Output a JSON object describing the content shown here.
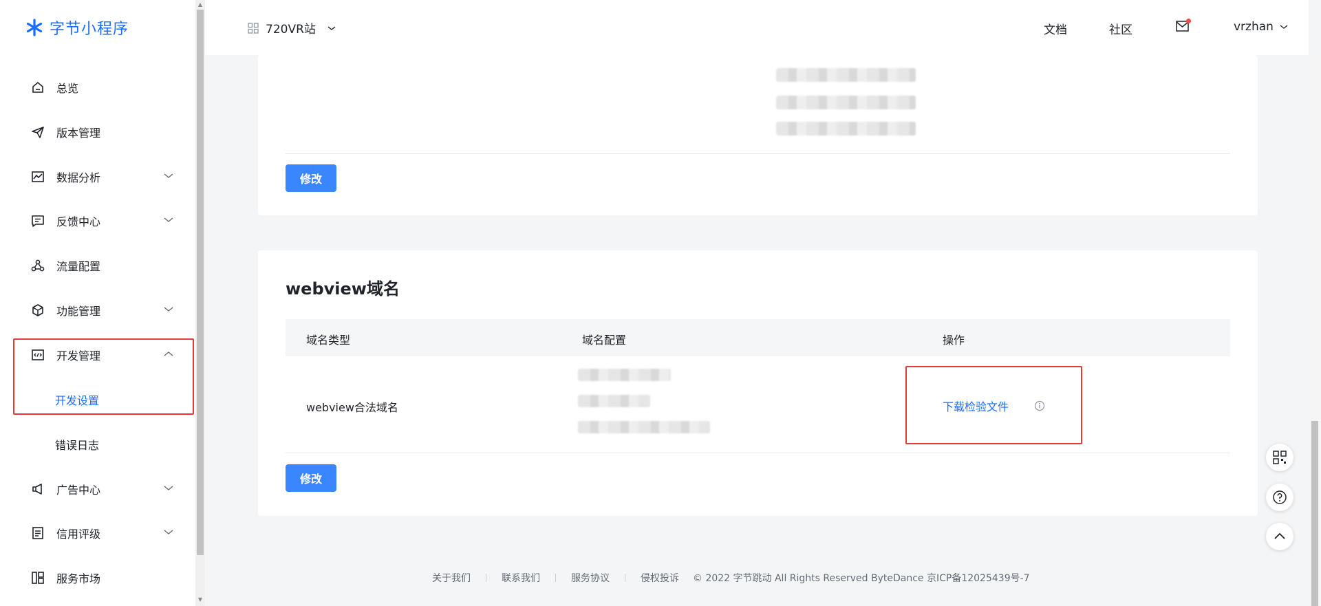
{
  "brand": {
    "name": "字节小程序",
    "accent": "#1a6cff"
  },
  "sidebar": {
    "items": [
      {
        "label": "总览",
        "icon": "home-icon"
      },
      {
        "label": "版本管理",
        "icon": "send-icon"
      },
      {
        "label": "数据分析",
        "icon": "chart-icon"
      },
      {
        "label": "反馈中心",
        "icon": "message-icon"
      },
      {
        "label": "流量配置",
        "icon": "network-icon"
      },
      {
        "label": "功能管理",
        "icon": "cube-icon"
      },
      {
        "label": "开发管理",
        "icon": "code-icon"
      },
      {
        "label": "广告中心",
        "icon": "megaphone-icon"
      },
      {
        "label": "信用评级",
        "icon": "list-icon"
      },
      {
        "label": "服务市场",
        "icon": "layout-icon"
      }
    ],
    "sub_items": {
      "dev_settings": "开发设置",
      "error_log": "错误日志"
    }
  },
  "header": {
    "app_name": "720VR站",
    "docs": "文档",
    "community": "社区",
    "user": "vrzhan"
  },
  "card1": {
    "modify": "修改"
  },
  "card2": {
    "title": "webview域名",
    "columns": [
      "域名类型",
      "域名配置",
      "操作"
    ],
    "row": {
      "type": "webview合法域名",
      "action": "下载检验文件"
    },
    "modify": "修改"
  },
  "footer": {
    "links": [
      "关于我们",
      "联系我们",
      "服务协议",
      "侵权投诉"
    ],
    "copyright": "© 2022 字节跳动 All Rights Reserved ByteDance 京ICP备12025439号-7"
  }
}
